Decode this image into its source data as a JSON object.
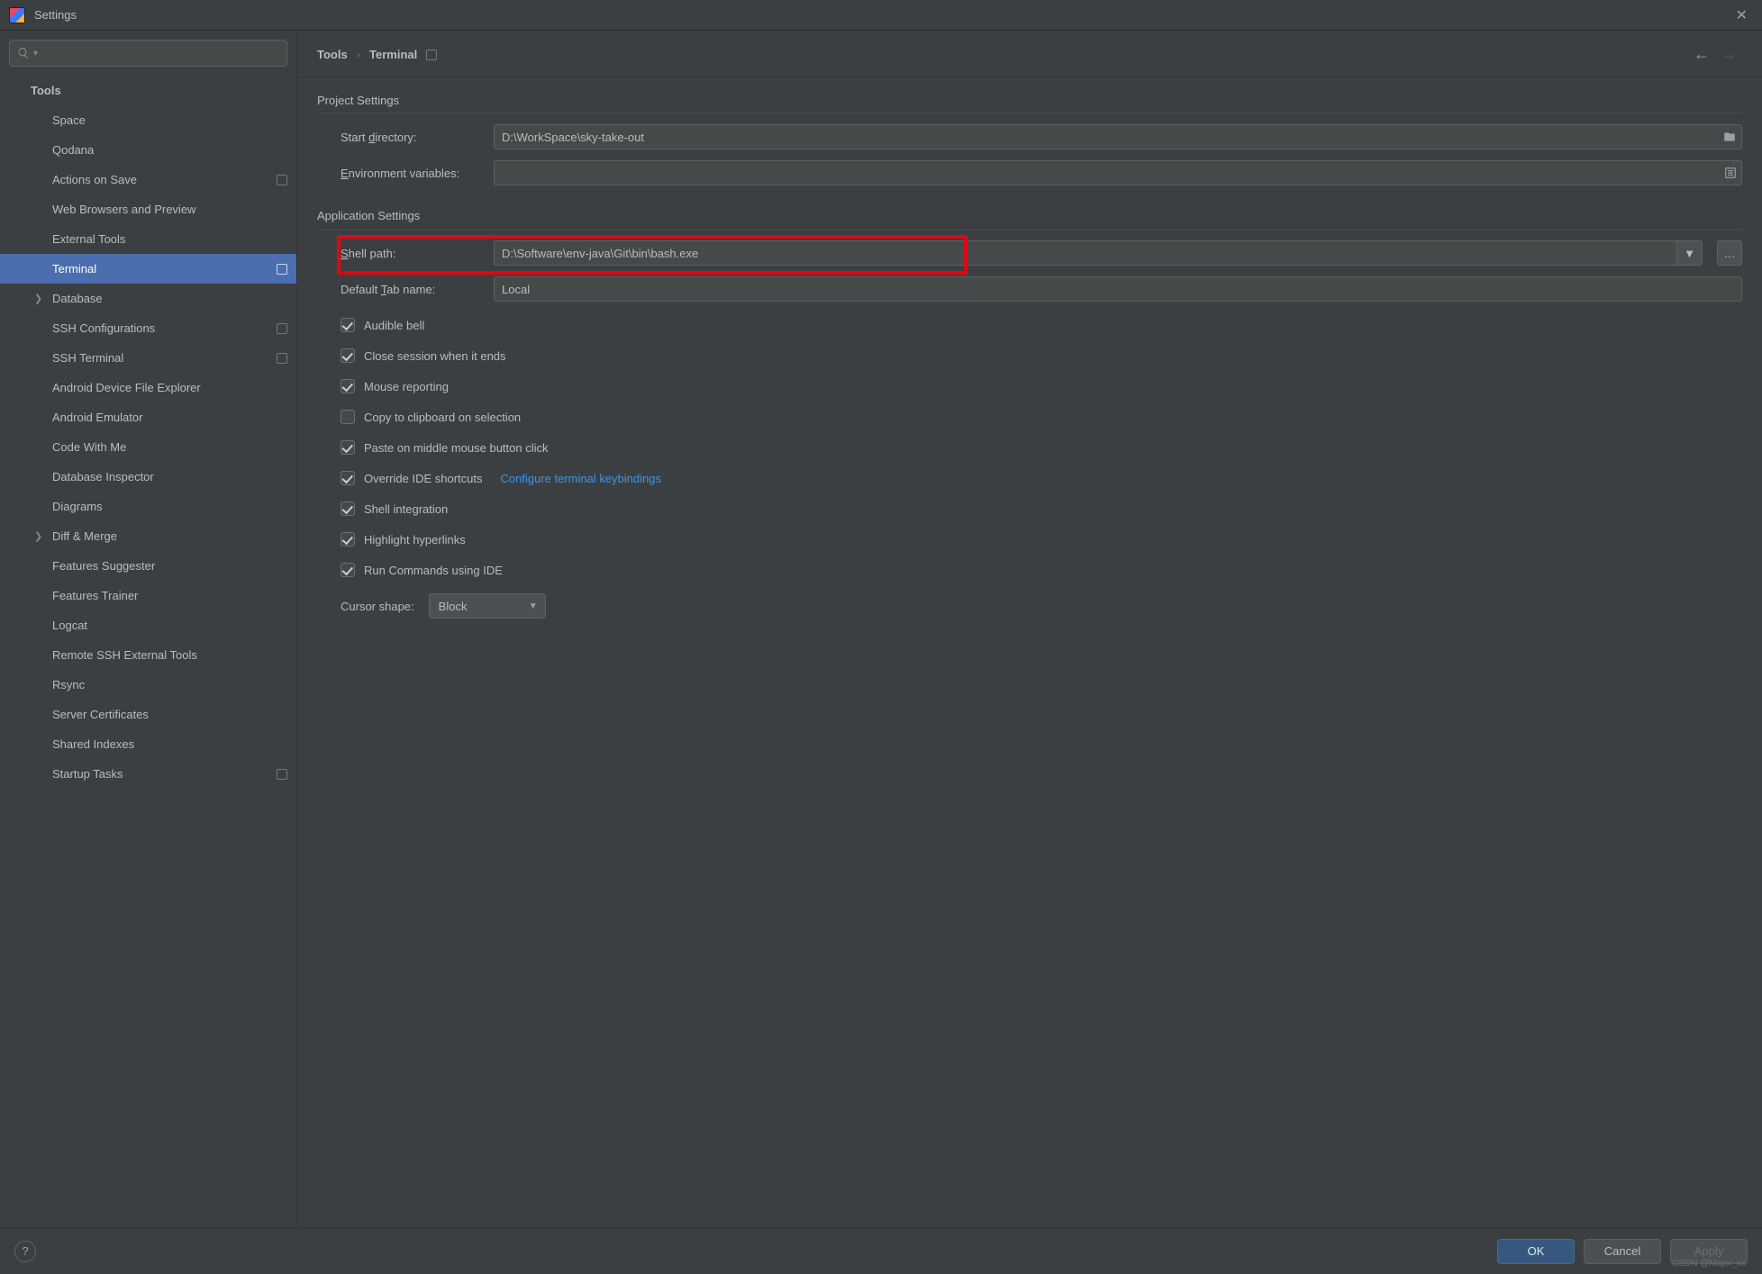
{
  "title": "Settings",
  "sidebar": {
    "root": "Tools",
    "items": [
      {
        "label": "Space",
        "badge": false
      },
      {
        "label": "Qodana",
        "badge": false
      },
      {
        "label": "Actions on Save",
        "badge": true
      },
      {
        "label": "Web Browsers and Preview",
        "badge": false
      },
      {
        "label": "External Tools",
        "badge": false
      },
      {
        "label": "Terminal",
        "badge": true,
        "selected": true
      },
      {
        "label": "Database",
        "badge": false,
        "chev": true
      },
      {
        "label": "SSH Configurations",
        "badge": true
      },
      {
        "label": "SSH Terminal",
        "badge": true
      },
      {
        "label": "Android Device File Explorer",
        "badge": false
      },
      {
        "label": "Android Emulator",
        "badge": false
      },
      {
        "label": "Code With Me",
        "badge": false
      },
      {
        "label": "Database Inspector",
        "badge": false
      },
      {
        "label": "Diagrams",
        "badge": false
      },
      {
        "label": "Diff & Merge",
        "badge": false,
        "chev": true
      },
      {
        "label": "Features Suggester",
        "badge": false
      },
      {
        "label": "Features Trainer",
        "badge": false
      },
      {
        "label": "Logcat",
        "badge": false
      },
      {
        "label": "Remote SSH External Tools",
        "badge": false
      },
      {
        "label": "Rsync",
        "badge": false
      },
      {
        "label": "Server Certificates",
        "badge": false
      },
      {
        "label": "Shared Indexes",
        "badge": false
      },
      {
        "label": "Startup Tasks",
        "badge": true
      }
    ]
  },
  "breadcrumb": {
    "a": "Tools",
    "b": "Terminal"
  },
  "project": {
    "title": "Project Settings",
    "start_dir_label_pre": "Start ",
    "start_dir_label_ul": "d",
    "start_dir_label_post": "irectory:",
    "start_dir_value": "D:\\WorkSpace\\sky-take-out",
    "env_label_ul": "E",
    "env_label_post": "nvironment variables:",
    "env_value": ""
  },
  "app": {
    "title": "Application Settings",
    "shell_label_ul": "S",
    "shell_label_post": "hell path:",
    "shell_value": "D:\\Software\\env-java\\Git\\bin\\bash.exe",
    "tab_label_pre": "Default ",
    "tab_label_ul": "T",
    "tab_label_post": "ab name:",
    "tab_value": "Local",
    "checks": [
      {
        "label": "Audible bell",
        "checked": true
      },
      {
        "label": "Close session when it ends",
        "checked": true
      },
      {
        "label": "Mouse reporting",
        "checked": true
      },
      {
        "label": "Copy to clipboard on selection",
        "checked": false
      },
      {
        "label": "Paste on middle mouse button click",
        "checked": true
      },
      {
        "label": "Override IDE shortcuts",
        "checked": true,
        "link": "Configure terminal keybindings"
      },
      {
        "label": "Shell integration",
        "checked": true
      },
      {
        "label": "Highlight hyperlinks",
        "checked": true
      },
      {
        "label": "Run Commands using IDE",
        "checked": true
      }
    ],
    "cursor_label": "Cursor shape:",
    "cursor_value": "Block"
  },
  "buttons": {
    "ok": "OK",
    "cancel": "Cancel",
    "apply": "Apply"
  },
  "watermark": "CSDN @Major_xx"
}
